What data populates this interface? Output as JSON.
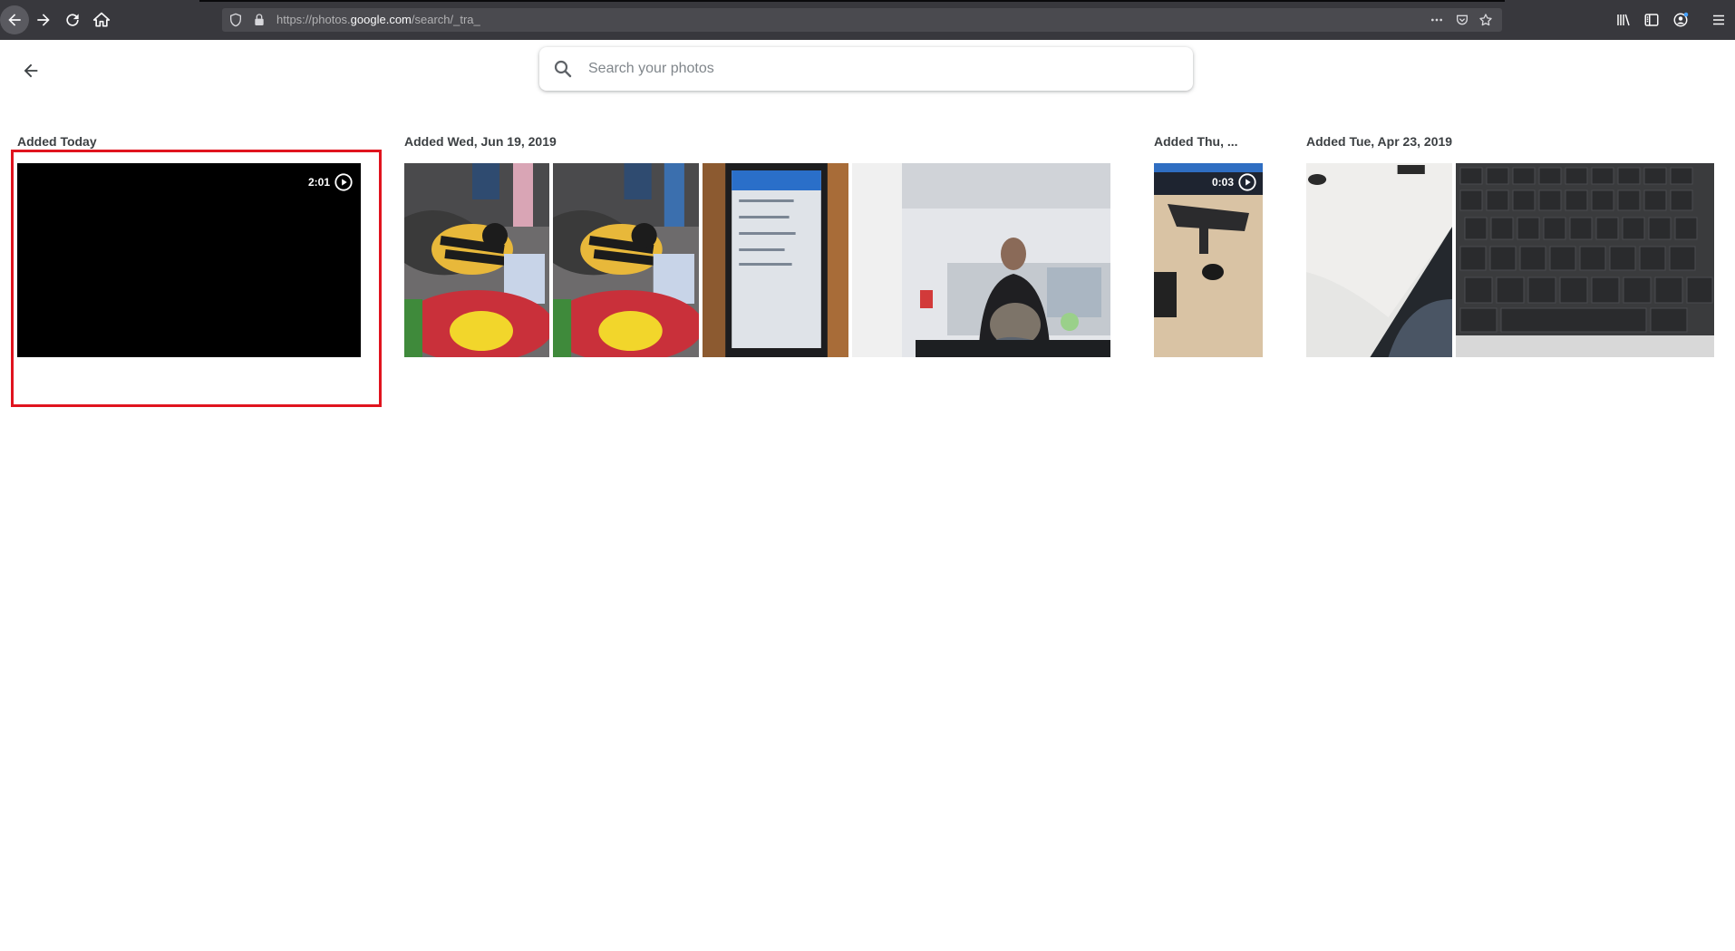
{
  "browser": {
    "url_prefix": "https://photos.",
    "url_domain": "google.com",
    "url_path": "/search/_tra_",
    "icons": [
      "back-icon",
      "forward-icon",
      "reload-icon",
      "home-icon",
      "shield-icon",
      "lock-icon",
      "more-icon",
      "pocket-icon",
      "star-icon",
      "library-icon",
      "sidebar-icon",
      "account-icon",
      "menu-icon"
    ]
  },
  "search": {
    "placeholder": "Search your photos",
    "value": ""
  },
  "groups": [
    {
      "title": "Added Today"
    },
    {
      "title": "Added Wed, Jun 19, 2019"
    },
    {
      "title": "Added Thu, ..."
    },
    {
      "title": "Added Tue, Apr 23, 2019"
    }
  ],
  "videos": [
    {
      "duration": "2:01"
    },
    {
      "duration": "0:03"
    }
  ],
  "colors": {
    "highlight": "#e0141e",
    "chrome": "#38383d"
  }
}
